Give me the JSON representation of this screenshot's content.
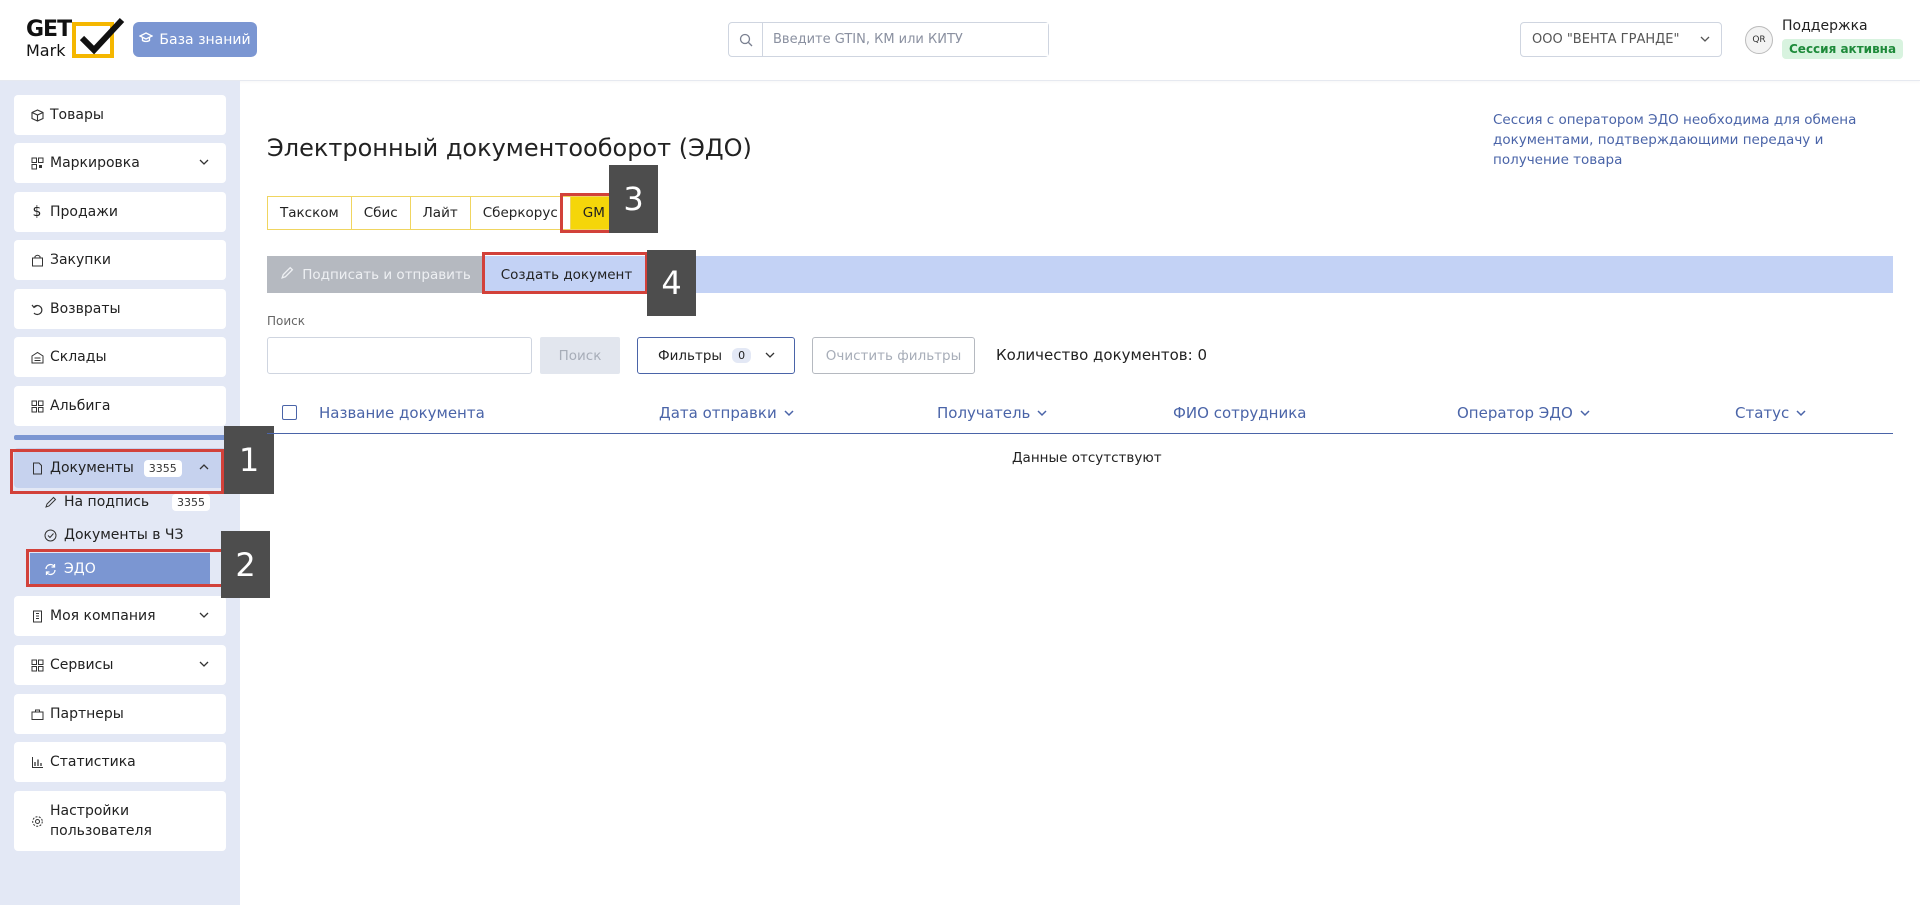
{
  "header": {
    "logo_line1": "GET",
    "logo_line2": "Mark",
    "knowledge_base_label": "База знаний",
    "search_placeholder": "Введите GTIN, КМ или КИТУ",
    "company_name": "ООО \"ВЕНТА ГРАНДЕ\"",
    "support_label": "Поддержка",
    "session_status": "Сессия активна"
  },
  "sidebar": {
    "items": [
      {
        "label": "Товары",
        "icon": "box-icon"
      },
      {
        "label": "Маркировка",
        "icon": "qr-icon"
      },
      {
        "label": "Продажи",
        "icon": "dollar-icon"
      },
      {
        "label": "Закупки",
        "icon": "bag-icon"
      },
      {
        "label": "Возвраты",
        "icon": "return-icon"
      },
      {
        "label": "Склады",
        "icon": "warehouse-icon"
      },
      {
        "label": "Альбига",
        "icon": "grid-icon"
      },
      {
        "label": "Документы",
        "icon": "document-icon",
        "count": "3355"
      },
      {
        "label": "Моя компания",
        "icon": "building-icon"
      },
      {
        "label": "Сервисы",
        "icon": "services-icon"
      },
      {
        "label": "Партнеры",
        "icon": "briefcase-icon"
      },
      {
        "label": "Статистика",
        "icon": "chart-icon"
      },
      {
        "label": "Настройки пользователя",
        "icon": "gear-icon"
      }
    ],
    "docs_sub": [
      {
        "label": "На подпись",
        "icon": "pen-icon",
        "count": "3355"
      },
      {
        "label": "Документы в ЧЗ",
        "icon": "check-circle-icon"
      },
      {
        "label": "ЭДО",
        "icon": "sync-icon"
      }
    ]
  },
  "annotations": [
    "1",
    "2",
    "3",
    "4"
  ],
  "main": {
    "title": "Электронный документооборот (ЭДО)",
    "info": "Сессия с оператором ЭДО необходима для обмена документами, подтверждающими передачу и получение товара",
    "operators": [
      "Такском",
      "Сбис",
      "Лайт",
      "Сберкорус",
      "GM"
    ],
    "active_operator": "GM",
    "sign_send_label": "Подписать и отправить",
    "create_doc_label": "Создать документ",
    "search_label": "Поиск",
    "search_button": "Поиск",
    "filters_label": "Фильтры",
    "filters_count": "0",
    "clear_filters_label": "Очистить фильтры",
    "doc_count_label": "Количество документов: 0",
    "columns": [
      "Название документа",
      "Дата отправки",
      "Получатель",
      "ФИО сотрудника",
      "Оператор ЭДО",
      "Статус"
    ],
    "empty_message": "Данные отсутствуют"
  },
  "colors": {
    "accent": "#7b96d2",
    "link": "#4a64a8",
    "active_tab": "#f5d60a",
    "annotation_border": "#d2413a"
  }
}
